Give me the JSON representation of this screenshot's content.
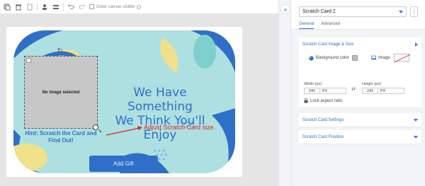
{
  "toolbar": {
    "outer_canvas_label": "Outer canvas visible",
    "info_glyph": "i",
    "icons": [
      "duplicate-icon",
      "delete-icon",
      "paste-icon",
      "user-icon",
      "layers-icon",
      "undo-icon",
      "redo-icon"
    ]
  },
  "collapse_glyph": "»",
  "canvas": {
    "headline_line1": "We Have Something",
    "headline_line2": "We Think You'll Enjoy",
    "hint": "Hint: Scratch the Card and Find Out!",
    "image_placeholder": "No image selected",
    "rotate_glyph": "↻",
    "resize_glyph": "↘",
    "add_gift_label": "Add Gift",
    "annotation": "Adjust Scratch Card size.",
    "colors": {
      "card_bg": "#aee0e1",
      "accent_blue": "#2f6fc7",
      "annotation_red": "#e02020"
    }
  },
  "panel": {
    "selected_item": "Scratch Card 2",
    "more_glyph": "⋮",
    "tabs": [
      {
        "label": "General",
        "active": true
      },
      {
        "label": "Advanced",
        "active": false
      }
    ],
    "section_image_size": {
      "title": "Scratch Card Image & Size",
      "bg_color_label": "Background color",
      "image_label": "Image",
      "width_label": "Width (px)",
      "height_label": "Height (px)",
      "width_value": "241",
      "height_value": "241",
      "unit": "PX",
      "lock_label": "Lock aspect ratio"
    },
    "section_settings": {
      "title": "Scratch Card Settings"
    },
    "section_position": {
      "title": "Scratch Card Position"
    }
  }
}
